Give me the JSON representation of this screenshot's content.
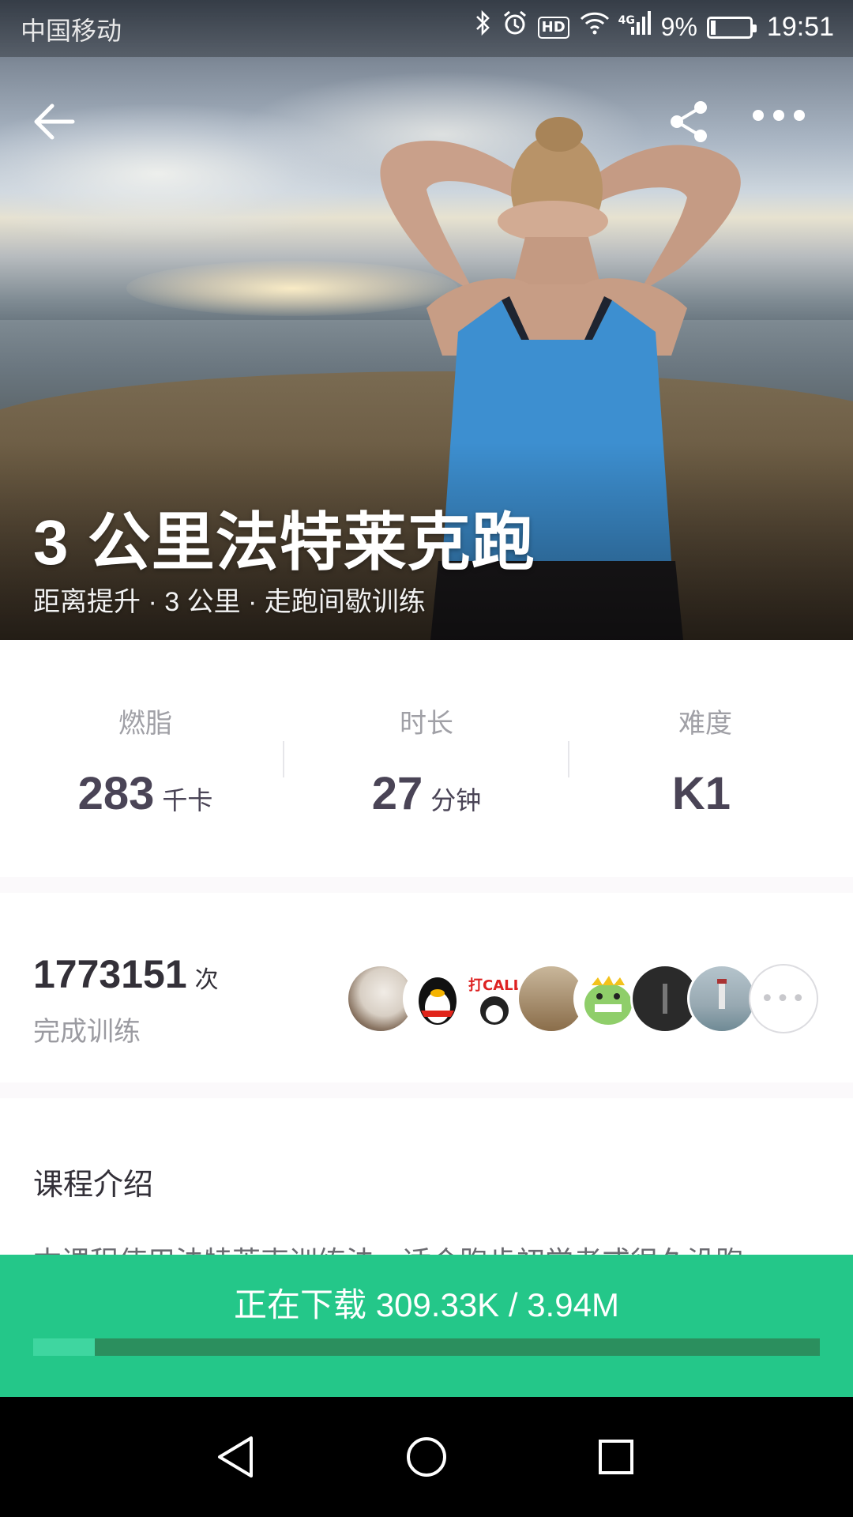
{
  "status_bar": {
    "carrier": "中国移动",
    "hd_label": "HD",
    "network_label": "4G",
    "battery_percent": "9%",
    "time": "19:51"
  },
  "course": {
    "title": "3 公里法特莱克跑",
    "subtitle": "距离提升 · 3 公里 · 走跑间歇训练"
  },
  "stats": [
    {
      "label": "燃脂",
      "value": "283",
      "unit": "千卡"
    },
    {
      "label": "时长",
      "value": "27",
      "unit": "分钟"
    },
    {
      "label": "难度",
      "value": "K1",
      "unit": ""
    }
  ],
  "completions": {
    "count": "1773151",
    "unit": "次",
    "label": "完成训练",
    "more_label": "•••"
  },
  "intro": {
    "title": "课程介绍",
    "text": "本课程使用法特莱克训练法，适合跑步初学者或很久没跑"
  },
  "download": {
    "text": "正在下载 309.33K / 3.94M",
    "progress": 0.078
  },
  "colors": {
    "accent": "#24c789",
    "progress_track": "#2b8f5e",
    "progress_fill": "#3fd6a0",
    "stat_value": "#4a4456"
  },
  "icons": {
    "back": "arrow-left-icon",
    "share": "share-icon",
    "more": "more-horizontal-icon",
    "nav_back": "triangle-back-icon",
    "nav_home": "circle-home-icon",
    "nav_recent": "square-recent-icon"
  }
}
